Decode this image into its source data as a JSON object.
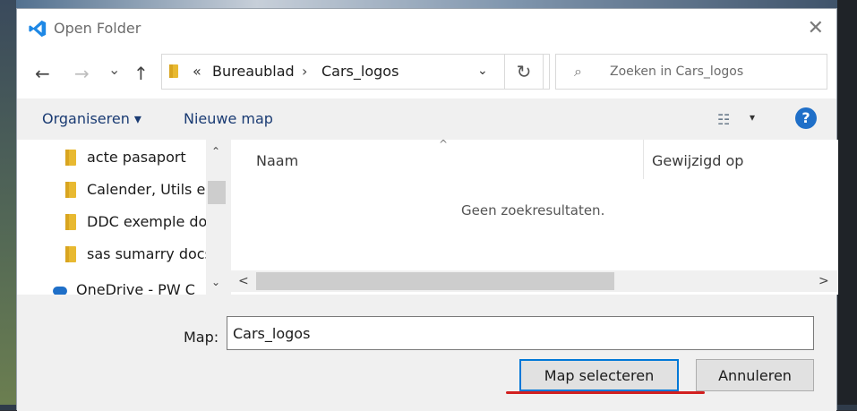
{
  "window": {
    "title": "Open Folder",
    "close_glyph": "✕"
  },
  "nav": {
    "back_glyph": "←",
    "forward_glyph": "→",
    "recent_glyph": "⌄",
    "up_glyph": "↑"
  },
  "address": {
    "overflow": "«",
    "crumbs": [
      "Bureaublad",
      "Cars_logos"
    ],
    "separator": "›",
    "dropdown_glyph": "⌄",
    "refresh_glyph": "↻"
  },
  "search": {
    "placeholder": "Zoeken in Cars_logos",
    "icon": "search-icon"
  },
  "commands": {
    "organize": "Organiseren ▾",
    "new_folder": "Nieuwe map",
    "view_glyph": "☷",
    "view_dropdown_glyph": "▾",
    "help_glyph": "?"
  },
  "tree": {
    "items": [
      {
        "label": "acte pasaport"
      },
      {
        "label": "Calender, Utils en"
      },
      {
        "label": "DDC exemple doc"
      },
      {
        "label": "sas sumarry docs"
      }
    ],
    "partial_item": "OneDrive - PW C"
  },
  "columns": {
    "name": "Naam",
    "modified": "Gewijzigd op",
    "sort_glyph": "^"
  },
  "content": {
    "empty_message": "Geen zoekresultaten."
  },
  "form": {
    "map_label": "Map:",
    "map_value": "Cars_logos",
    "select_button": "Map selecteren",
    "cancel_button": "Annuleren"
  },
  "scroll": {
    "up": "⌃",
    "down": "⌄",
    "left": "<",
    "right": ">"
  },
  "colors": {
    "accent": "#0078d7",
    "underline_annotation": "#d21f1f",
    "folder": "#e8b931"
  }
}
